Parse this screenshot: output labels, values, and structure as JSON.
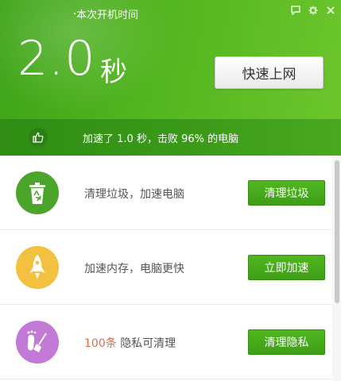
{
  "header": {
    "title": "本次开机时间",
    "time_value": "2.0",
    "time_unit": "秒",
    "primary_button": "快速上网",
    "controls": [
      "feedback-icon",
      "settings-icon",
      "close-icon"
    ]
  },
  "summary": {
    "text": "加速了 1.0 秒，击败 96% 的电脑",
    "icon": "thumbs-up-icon"
  },
  "items": [
    {
      "icon": "recycle-trash-icon",
      "color": "#4aa52a",
      "desc": "清理垃圾，加速电脑",
      "action": "清理垃圾"
    },
    {
      "icon": "rocket-icon",
      "color": "#f3c13f",
      "desc": "加速内存，电脑更快",
      "action": "立即加速"
    },
    {
      "icon": "footprint-broom-icon",
      "color": "#c27ad6",
      "count": "100条",
      "desc": "隐私可清理",
      "action": "清理隐私"
    }
  ],
  "colors": {
    "brand_green": "#4aae1d",
    "button_green": "#46a81a",
    "highlight_red": "#e06b4e"
  }
}
